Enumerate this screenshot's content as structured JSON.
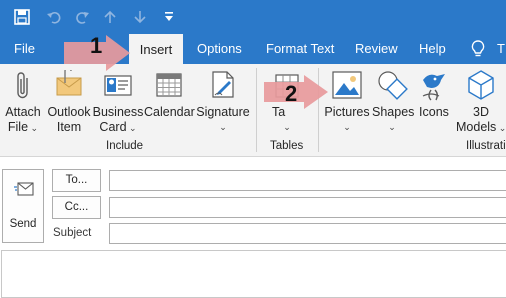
{
  "menu": {
    "tabs": [
      "File",
      "Insert",
      "Options",
      "Format Text",
      "Review",
      "Help"
    ],
    "tell_me_partial": "T"
  },
  "ribbon": {
    "include": {
      "items": [
        {
          "label1": "Attach",
          "label2": "File",
          "icon": "paperclip-icon"
        },
        {
          "label1": "Outlook",
          "label2": "Item",
          "icon": "envelope-icon"
        },
        {
          "label1": "Business",
          "label2": "Card",
          "icon": "business-card-icon"
        },
        {
          "label1": "Calendar",
          "icon": "calendar-icon"
        },
        {
          "label1": "Signature",
          "icon": "signature-icon"
        }
      ],
      "group_label": "Include"
    },
    "tables": {
      "item_label_partial": "Ta",
      "group_label": "Tables"
    },
    "illustrations": {
      "items": [
        {
          "label1": "Pictures",
          "icon": "pictures-icon"
        },
        {
          "label1": "Shapes",
          "icon": "shapes-icon"
        },
        {
          "label1": "Icons",
          "icon": "icons-icon"
        },
        {
          "label1": "3D",
          "label2": "Models",
          "icon": "3d-models-icon"
        }
      ],
      "group_label_partial": "Illustrati"
    }
  },
  "compose": {
    "send_label": "Send",
    "to_label": "To...",
    "cc_label": "Cc...",
    "subject_label": "Subject"
  },
  "callouts": {
    "step1": "1",
    "step2": "2"
  },
  "colors": {
    "titlebar": "#2b79c9",
    "ribbon": "#f3f3f3",
    "callout_arrow": "#e89a9c"
  }
}
